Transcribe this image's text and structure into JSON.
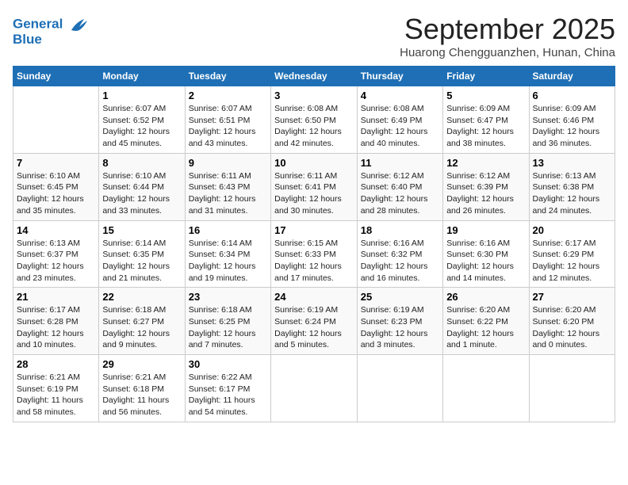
{
  "header": {
    "logo_line1": "General",
    "logo_line2": "Blue",
    "month": "September 2025",
    "location": "Huarong Chengguanzhen, Hunan, China"
  },
  "days_of_week": [
    "Sunday",
    "Monday",
    "Tuesday",
    "Wednesday",
    "Thursday",
    "Friday",
    "Saturday"
  ],
  "weeks": [
    [
      {
        "day": "",
        "info": ""
      },
      {
        "day": "1",
        "info": "Sunrise: 6:07 AM\nSunset: 6:52 PM\nDaylight: 12 hours\nand 45 minutes."
      },
      {
        "day": "2",
        "info": "Sunrise: 6:07 AM\nSunset: 6:51 PM\nDaylight: 12 hours\nand 43 minutes."
      },
      {
        "day": "3",
        "info": "Sunrise: 6:08 AM\nSunset: 6:50 PM\nDaylight: 12 hours\nand 42 minutes."
      },
      {
        "day": "4",
        "info": "Sunrise: 6:08 AM\nSunset: 6:49 PM\nDaylight: 12 hours\nand 40 minutes."
      },
      {
        "day": "5",
        "info": "Sunrise: 6:09 AM\nSunset: 6:47 PM\nDaylight: 12 hours\nand 38 minutes."
      },
      {
        "day": "6",
        "info": "Sunrise: 6:09 AM\nSunset: 6:46 PM\nDaylight: 12 hours\nand 36 minutes."
      }
    ],
    [
      {
        "day": "7",
        "info": "Sunrise: 6:10 AM\nSunset: 6:45 PM\nDaylight: 12 hours\nand 35 minutes."
      },
      {
        "day": "8",
        "info": "Sunrise: 6:10 AM\nSunset: 6:44 PM\nDaylight: 12 hours\nand 33 minutes."
      },
      {
        "day": "9",
        "info": "Sunrise: 6:11 AM\nSunset: 6:43 PM\nDaylight: 12 hours\nand 31 minutes."
      },
      {
        "day": "10",
        "info": "Sunrise: 6:11 AM\nSunset: 6:41 PM\nDaylight: 12 hours\nand 30 minutes."
      },
      {
        "day": "11",
        "info": "Sunrise: 6:12 AM\nSunset: 6:40 PM\nDaylight: 12 hours\nand 28 minutes."
      },
      {
        "day": "12",
        "info": "Sunrise: 6:12 AM\nSunset: 6:39 PM\nDaylight: 12 hours\nand 26 minutes."
      },
      {
        "day": "13",
        "info": "Sunrise: 6:13 AM\nSunset: 6:38 PM\nDaylight: 12 hours\nand 24 minutes."
      }
    ],
    [
      {
        "day": "14",
        "info": "Sunrise: 6:13 AM\nSunset: 6:37 PM\nDaylight: 12 hours\nand 23 minutes."
      },
      {
        "day": "15",
        "info": "Sunrise: 6:14 AM\nSunset: 6:35 PM\nDaylight: 12 hours\nand 21 minutes."
      },
      {
        "day": "16",
        "info": "Sunrise: 6:14 AM\nSunset: 6:34 PM\nDaylight: 12 hours\nand 19 minutes."
      },
      {
        "day": "17",
        "info": "Sunrise: 6:15 AM\nSunset: 6:33 PM\nDaylight: 12 hours\nand 17 minutes."
      },
      {
        "day": "18",
        "info": "Sunrise: 6:16 AM\nSunset: 6:32 PM\nDaylight: 12 hours\nand 16 minutes."
      },
      {
        "day": "19",
        "info": "Sunrise: 6:16 AM\nSunset: 6:30 PM\nDaylight: 12 hours\nand 14 minutes."
      },
      {
        "day": "20",
        "info": "Sunrise: 6:17 AM\nSunset: 6:29 PM\nDaylight: 12 hours\nand 12 minutes."
      }
    ],
    [
      {
        "day": "21",
        "info": "Sunrise: 6:17 AM\nSunset: 6:28 PM\nDaylight: 12 hours\nand 10 minutes."
      },
      {
        "day": "22",
        "info": "Sunrise: 6:18 AM\nSunset: 6:27 PM\nDaylight: 12 hours\nand 9 minutes."
      },
      {
        "day": "23",
        "info": "Sunrise: 6:18 AM\nSunset: 6:25 PM\nDaylight: 12 hours\nand 7 minutes."
      },
      {
        "day": "24",
        "info": "Sunrise: 6:19 AM\nSunset: 6:24 PM\nDaylight: 12 hours\nand 5 minutes."
      },
      {
        "day": "25",
        "info": "Sunrise: 6:19 AM\nSunset: 6:23 PM\nDaylight: 12 hours\nand 3 minutes."
      },
      {
        "day": "26",
        "info": "Sunrise: 6:20 AM\nSunset: 6:22 PM\nDaylight: 12 hours\nand 1 minute."
      },
      {
        "day": "27",
        "info": "Sunrise: 6:20 AM\nSunset: 6:20 PM\nDaylight: 12 hours\nand 0 minutes."
      }
    ],
    [
      {
        "day": "28",
        "info": "Sunrise: 6:21 AM\nSunset: 6:19 PM\nDaylight: 11 hours\nand 58 minutes."
      },
      {
        "day": "29",
        "info": "Sunrise: 6:21 AM\nSunset: 6:18 PM\nDaylight: 11 hours\nand 56 minutes."
      },
      {
        "day": "30",
        "info": "Sunrise: 6:22 AM\nSunset: 6:17 PM\nDaylight: 11 hours\nand 54 minutes."
      },
      {
        "day": "",
        "info": ""
      },
      {
        "day": "",
        "info": ""
      },
      {
        "day": "",
        "info": ""
      },
      {
        "day": "",
        "info": ""
      }
    ]
  ]
}
